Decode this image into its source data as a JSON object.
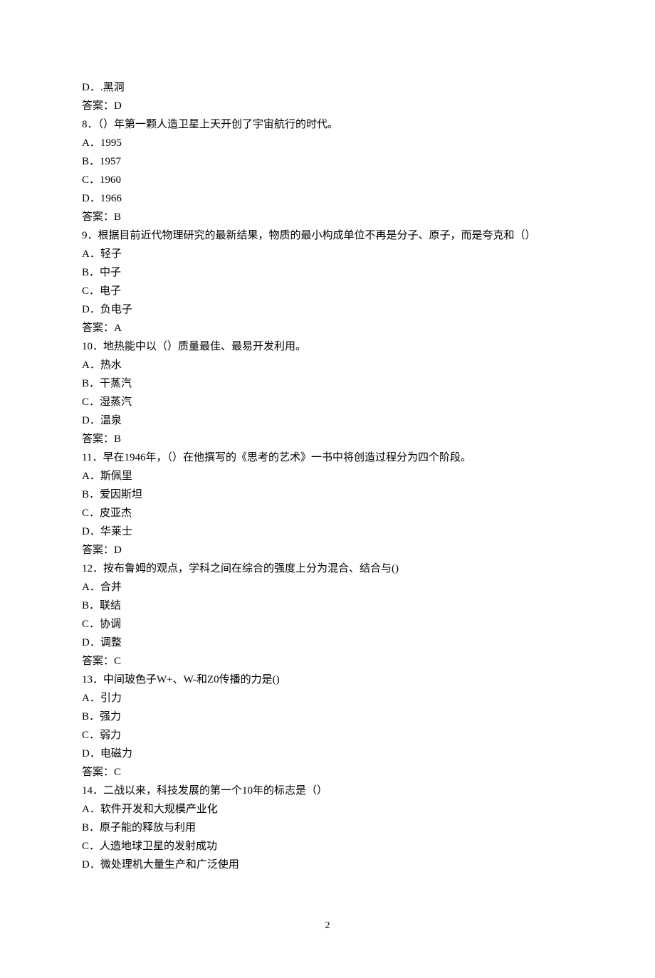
{
  "lines": [
    "D．.黑洞",
    "答案：D",
    "8．（）年第一颗人造卫星上天开创了宇宙航行的时代。",
    "A．1995",
    "B．1957",
    "C．1960",
    "D．1966",
    "答案：B",
    "9．根据目前近代物理研究的最新结果，物质的最小构成单位不再是分子、原子，而是夸克和（）",
    "A．轻子",
    "B．中子",
    "C．电子",
    "D．负电子",
    "答案：A",
    "10．地热能中以（）质量最佳、最易开发利用。",
    "A．热水",
    "B．干蒸汽",
    "C．湿蒸汽",
    "D．温泉",
    "答案：B",
    "11．早在1946年，（）在他撰写的《思考的艺术》一书中将创造过程分为四个阶段。",
    "A．斯佩里",
    "B．爱因斯坦",
    "C．皮亚杰",
    "D．华莱士",
    "答案：D",
    "12．按布鲁姆的观点，学科之间在综合的强度上分为混合、结合与()",
    "A．合并",
    "B．联结",
    "C．协调",
    "D．调整",
    "答案：C",
    "13．中间玻色子W+、W-和Z0传播的力是()",
    "A．引力",
    "B．强力",
    "C．弱力",
    "D．电磁力",
    "答案：C",
    "14．二战以来，科技发展的第一个10年的标志是（）",
    "A．软件开发和大规模产业化",
    "B．原子能的释放与利用",
    "C．人造地球卫星的发射成功",
    "D．微处理机大量生产和广泛使用"
  ],
  "pageNumber": "2"
}
